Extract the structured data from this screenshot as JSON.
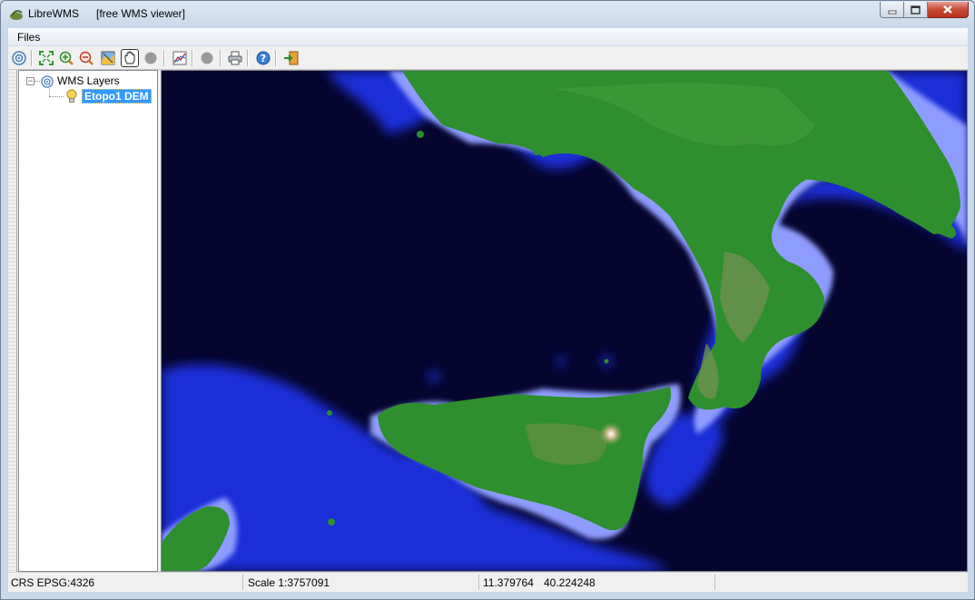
{
  "window": {
    "app_name": "LibreWMS",
    "subtitle": "[free WMS viewer]"
  },
  "menu": {
    "files_label": "Files"
  },
  "toolbar": {
    "icons": [
      "wms-connect-icon",
      "zoom-extent-icon",
      "zoom-in-icon",
      "zoom-out-icon",
      "zoom-layer-icon",
      "pan-hand-icon",
      "stop-icon",
      "legend-chart-icon",
      "record-icon",
      "print-icon",
      "help-icon",
      "exit-icon"
    ],
    "active_tool": "pan-hand-icon"
  },
  "tree": {
    "root_label": "WMS Layers",
    "layer_label": "Etopo1 DEM"
  },
  "status": {
    "crs": "CRS EPSG:4326",
    "scale": "Scale 1:3757091",
    "lon": "11.379764",
    "lat": "40.224248"
  },
  "colors": {
    "deep_sea": "#05052e",
    "shallow_sea": "#1c2fd8",
    "coast_shelf": "#8f9cff",
    "lowland": "#2e8f2e",
    "upland": "#7c9a57",
    "selection": "#3399ff"
  }
}
